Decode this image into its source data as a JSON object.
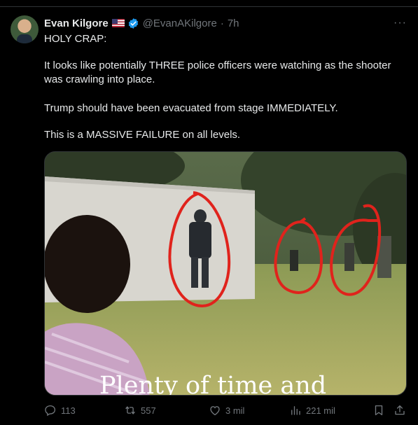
{
  "tweet": {
    "display_name": "Evan Kilgore",
    "handle": "@EvanAKilgore",
    "time_sep": "·",
    "time": "7h",
    "more": "···",
    "lines": [
      "HOLY CRAP:",
      "It looks like potentially THREE police officers were watching as the shooter was crawling into place.",
      "Trump should have been evacuated from stage IMMEDIATELY.",
      "This is a MASSIVE FAILURE on all levels."
    ],
    "video_caption": "Plenty of time and"
  },
  "actions": {
    "replies": "113",
    "reposts": "557",
    "likes": "3 mil",
    "views": "221 mil"
  },
  "icons": [
    "verified-badge-icon",
    "flag-us-icon",
    "reply-icon",
    "repost-icon",
    "like-icon",
    "views-icon",
    "bookmark-icon",
    "share-icon",
    "more-icon"
  ],
  "colors": {
    "background": "#000000",
    "text": "#e7e9ea",
    "muted": "#71767b",
    "verified": "#1d9bf0",
    "annotation": "#e0231c"
  }
}
